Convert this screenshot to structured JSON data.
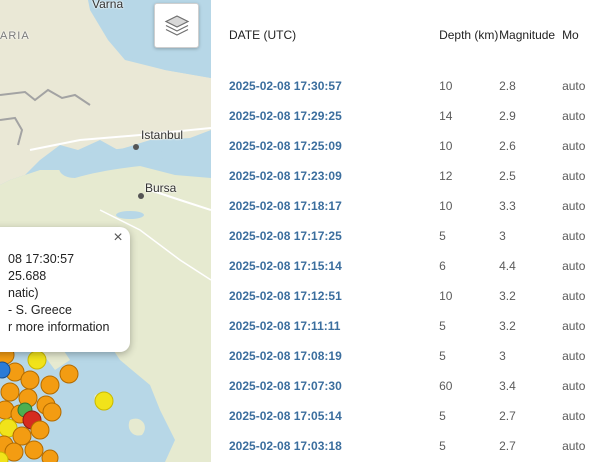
{
  "map": {
    "labels": {
      "varna": "Varna",
      "bulgaria_fragment": "ARIA",
      "istanbul": "Istanbul",
      "bursa": "Bursa"
    },
    "layers_button_icon": "layers-icon",
    "popup": {
      "close": "×",
      "line1": "08 17:30:57",
      "line2": "25.688",
      "line3": "natic)",
      "line4": "- S. Greece",
      "line5": "r more information"
    },
    "marker_colors": {
      "orange": "#f39c12",
      "yellow": "#f1e31a",
      "red": "#d62b1f",
      "green": "#4caf50",
      "blue": "#2b7bd6"
    }
  },
  "table": {
    "headers": {
      "date": "DATE (UTC)",
      "depth": "Depth (km)",
      "magnitude": "Magnitude",
      "mode": "Mo"
    },
    "rows": [
      {
        "date": "2025-02-08 17:30:57",
        "depth": "10",
        "magnitude": "2.8",
        "mode": "auto"
      },
      {
        "date": "2025-02-08 17:29:25",
        "depth": "14",
        "magnitude": "2.9",
        "mode": "auto"
      },
      {
        "date": "2025-02-08 17:25:09",
        "depth": "10",
        "magnitude": "2.6",
        "mode": "auto"
      },
      {
        "date": "2025-02-08 17:23:09",
        "depth": "12",
        "magnitude": "2.5",
        "mode": "auto"
      },
      {
        "date": "2025-02-08 17:18:17",
        "depth": "10",
        "magnitude": "3.3",
        "mode": "auto"
      },
      {
        "date": "2025-02-08 17:17:25",
        "depth": "5",
        "magnitude": "3",
        "mode": "auto"
      },
      {
        "date": "2025-02-08 17:15:14",
        "depth": "6",
        "magnitude": "4.4",
        "mode": "auto"
      },
      {
        "date": "2025-02-08 17:12:51",
        "depth": "10",
        "magnitude": "3.2",
        "mode": "auto"
      },
      {
        "date": "2025-02-08 17:11:11",
        "depth": "5",
        "magnitude": "3.2",
        "mode": "auto"
      },
      {
        "date": "2025-02-08 17:08:19",
        "depth": "5",
        "magnitude": "3",
        "mode": "auto"
      },
      {
        "date": "2025-02-08 17:07:30",
        "depth": "60",
        "magnitude": "3.4",
        "mode": "auto"
      },
      {
        "date": "2025-02-08 17:05:14",
        "depth": "5",
        "magnitude": "2.7",
        "mode": "auto"
      },
      {
        "date": "2025-02-08 17:03:18",
        "depth": "5",
        "magnitude": "2.7",
        "mode": "auto"
      }
    ]
  }
}
